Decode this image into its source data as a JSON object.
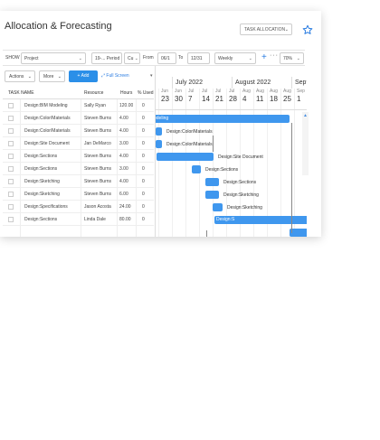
{
  "header": {
    "title": "Allocation & Forecasting",
    "view_select": "TASK ALLOCATION"
  },
  "filters": {
    "show_label": "SHOW",
    "show_value": "Project",
    "period_value": "19-... Period",
    "cu_value": "Cu",
    "from_label": "From",
    "from_value": "06/1",
    "to_label": "To",
    "to_value": "12/31",
    "interval_value": "Weekly",
    "zoom_value": "70%"
  },
  "toolbar": {
    "actions_label": "Actions",
    "more_label": "More",
    "add_label": "+ Add",
    "fullscreen_label": "Full Screen"
  },
  "grid": {
    "columns": [
      "TASK NAME",
      "Resource",
      "Hours",
      "% Used"
    ],
    "rows": [
      {
        "task": "Design:BIM Modeling",
        "resource": "Sally Ryan",
        "hours": "120.00",
        "used": "0"
      },
      {
        "task": "Design:Color/Materials",
        "resource": "Steven Burns",
        "hours": "4.00",
        "used": "0"
      },
      {
        "task": "Design:Color/Materials",
        "resource": "Steven Burns",
        "hours": "4.00",
        "used": "0"
      },
      {
        "task": "Design:Site Document",
        "resource": "Jan DeMarco",
        "hours": "3.00",
        "used": "0"
      },
      {
        "task": "Design:Sections",
        "resource": "Steven Burns",
        "hours": "4.00",
        "used": "0"
      },
      {
        "task": "Design:Sections",
        "resource": "Steven Burns",
        "hours": "3.00",
        "used": "0"
      },
      {
        "task": "Design:Sketching",
        "resource": "Steven Burns",
        "hours": "4.00",
        "used": "0"
      },
      {
        "task": "Design:Sketching",
        "resource": "Steven Burns",
        "hours": "6.00",
        "used": "0"
      },
      {
        "task": "Design:Specifications",
        "resource": "Jason Acosta",
        "hours": "24.00",
        "used": "0"
      },
      {
        "task": "Design:Sections",
        "resource": "Linda Dale",
        "hours": "80.00",
        "used": "0"
      }
    ]
  },
  "gantt": {
    "months": [
      "July 2022",
      "August 2022",
      "Septe"
    ],
    "ticks": [
      {
        "m": "Jun",
        "d": "23"
      },
      {
        "m": "Jun",
        "d": "30"
      },
      {
        "m": "Jul",
        "d": "7"
      },
      {
        "m": "Jul",
        "d": "14"
      },
      {
        "m": "Jul",
        "d": "21"
      },
      {
        "m": "Jul",
        "d": "28"
      },
      {
        "m": "Aug",
        "d": "4"
      },
      {
        "m": "Aug",
        "d": "11"
      },
      {
        "m": "Aug",
        "d": "18"
      },
      {
        "m": "Aug",
        "d": "25"
      },
      {
        "m": "Sep",
        "d": "1"
      }
    ],
    "bars": [
      {
        "label_inside": "odeling",
        "label_outside": ""
      },
      {
        "label_inside": "",
        "label_outside": "Design:Color/Materials"
      },
      {
        "label_inside": "",
        "label_outside": "Design:Color/Materials"
      },
      {
        "label_inside": "",
        "label_outside": "Design:Site Document"
      },
      {
        "label_inside": "",
        "label_outside": "Design:Sections"
      },
      {
        "label_inside": "",
        "label_outside": "Design:Sections"
      },
      {
        "label_inside": "",
        "label_outside": "Design:Sketching"
      },
      {
        "label_inside": "",
        "label_outside": "Design:Sketching"
      },
      {
        "label_inside": "Design:S",
        "label_outside": ""
      },
      {
        "label_inside": "",
        "label_outside": ""
      }
    ]
  },
  "colors": {
    "accent": "#2b8fe8",
    "bar": "#3f97ee"
  }
}
